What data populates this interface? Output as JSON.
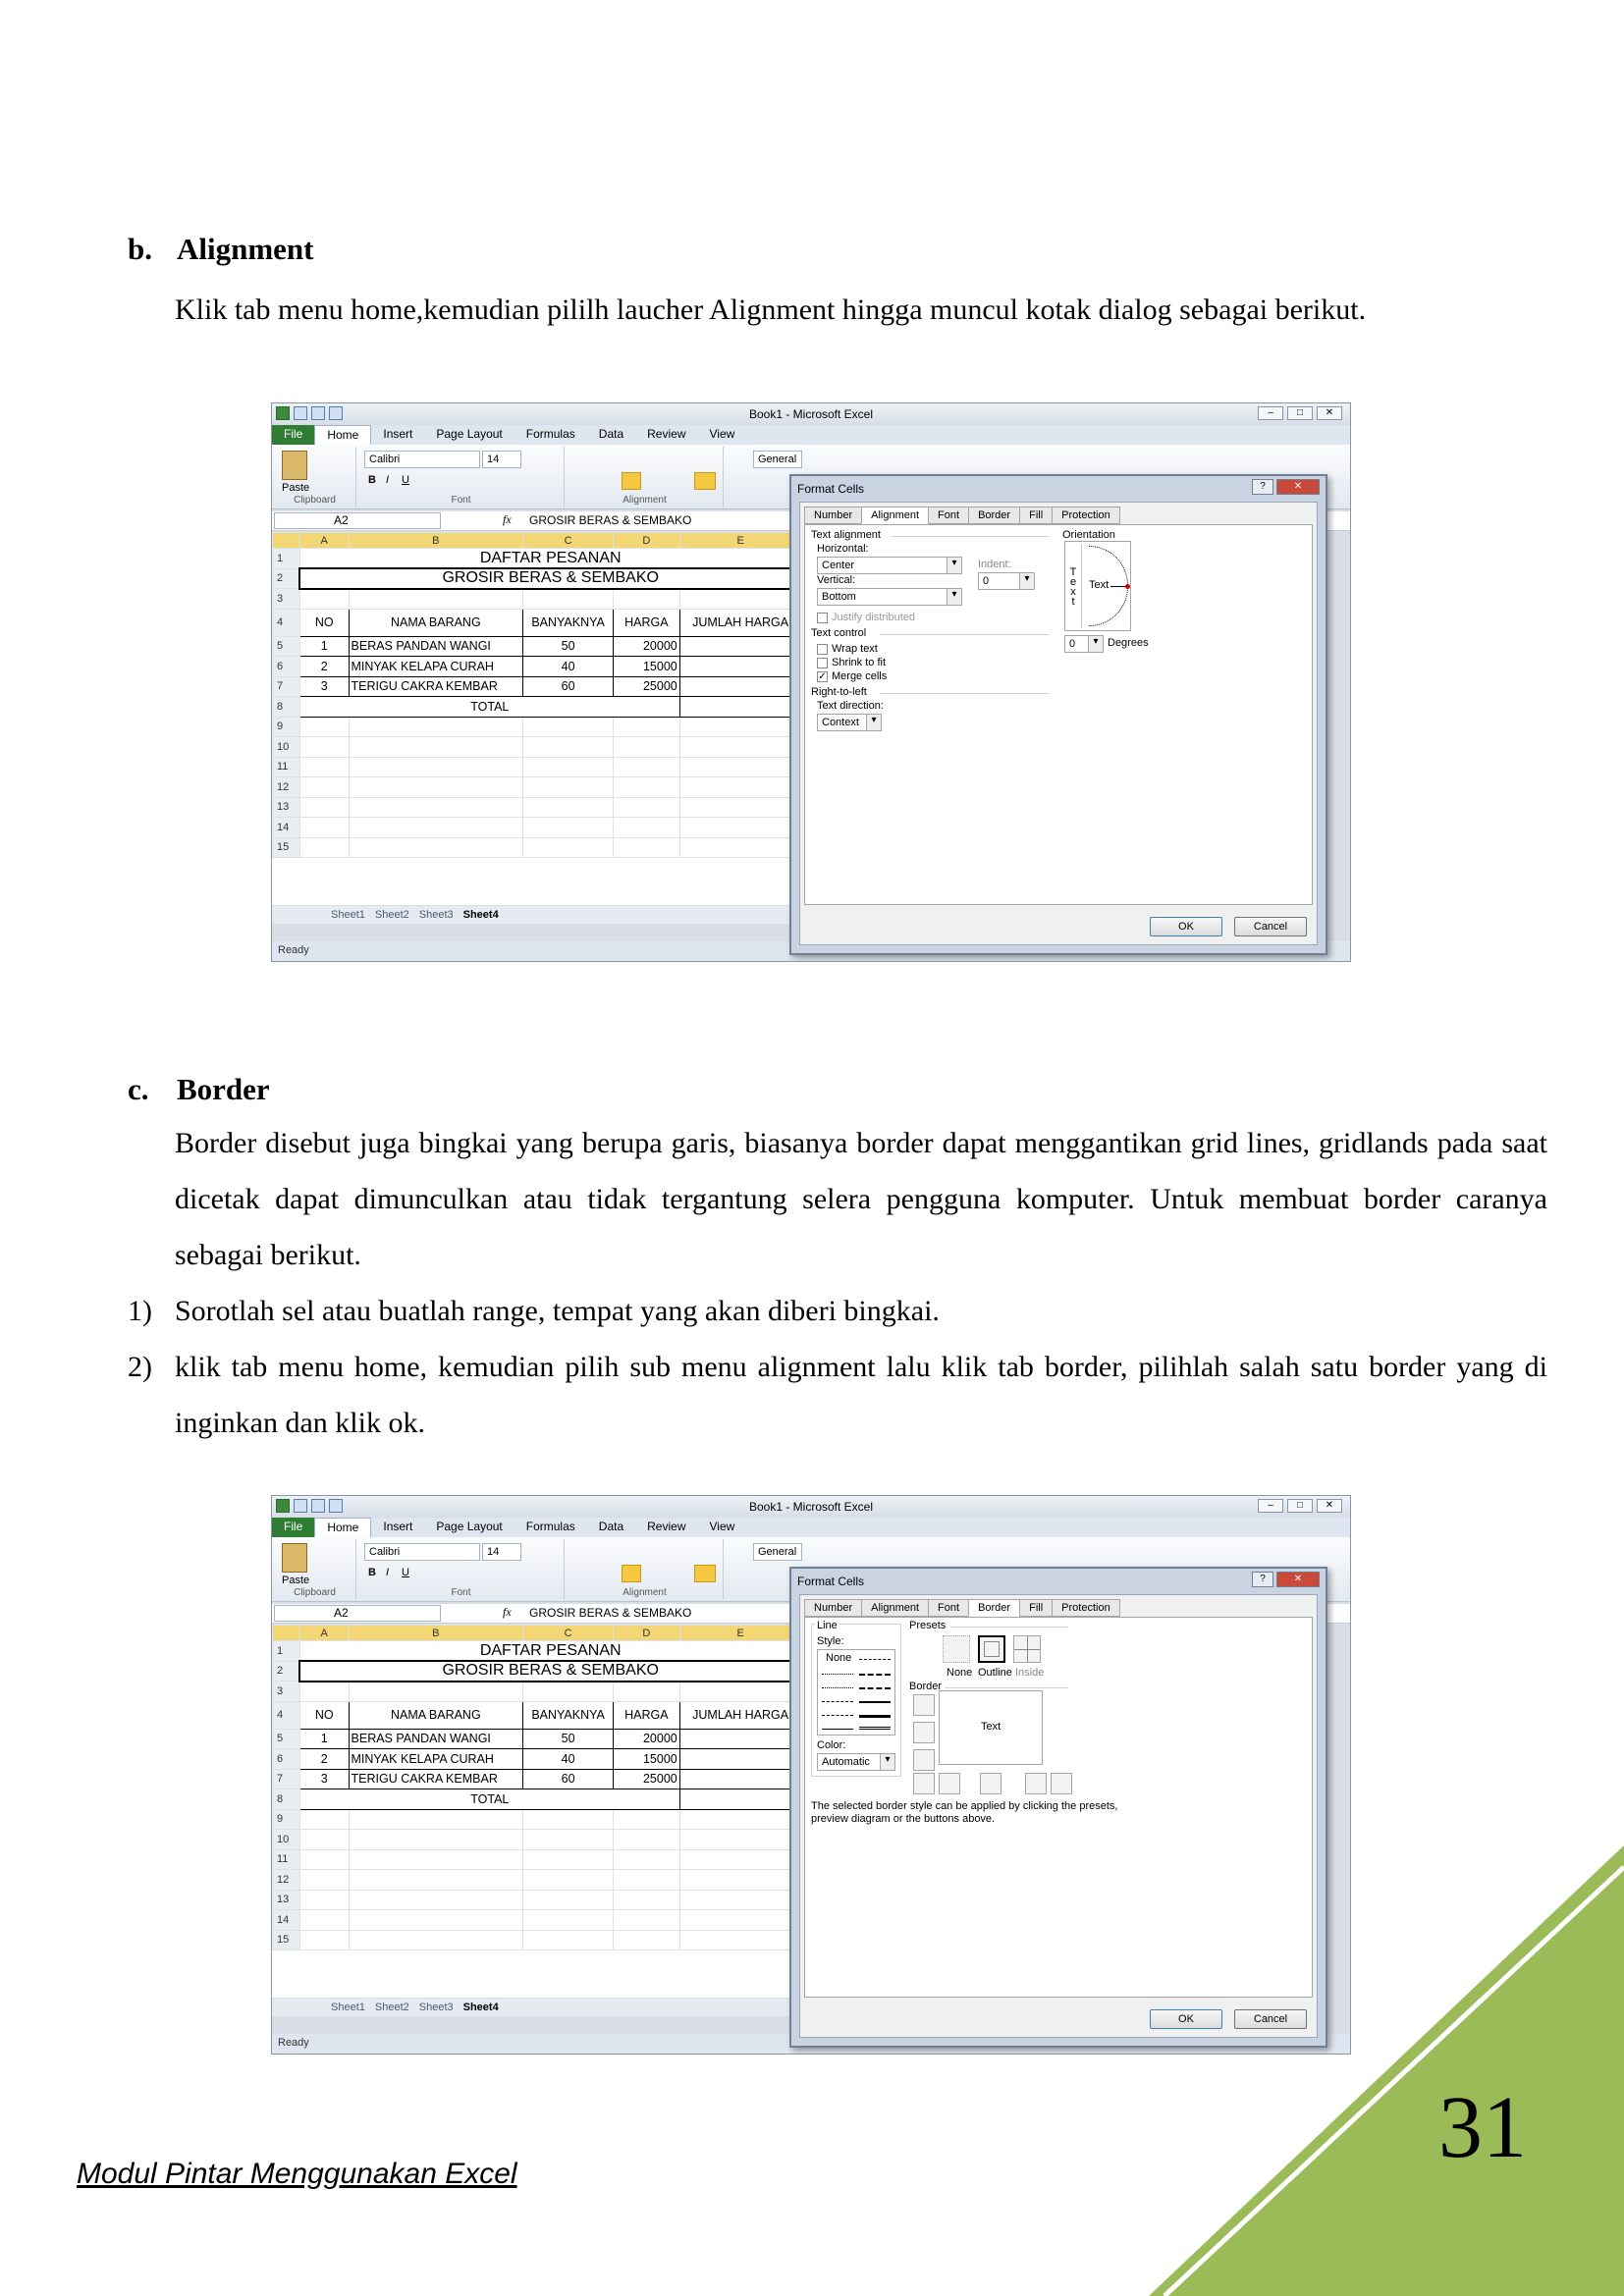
{
  "sections": {
    "b": {
      "letter": "b.",
      "title": "Alignment",
      "text": "Klik tab menu home,kemudian pililh laucher Alignment hingga muncul kotak dialog sebagai berikut."
    },
    "c": {
      "letter": "c.",
      "title": "Border",
      "text": "Border disebut juga bingkai yang berupa garis, biasanya border dapat menggantikan grid lines, gridlands pada saat dicetak dapat dimunculkan atau tidak tergantung selera pengguna komputer. Untuk membuat border caranya sebagai berikut."
    }
  },
  "steps": [
    {
      "n": "1)",
      "text": "Sorotlah  sel atau buatlah range, tempat yang akan diberi bingkai."
    },
    {
      "n": "2)",
      "text": "klik tab menu home, kemudian pilih sub menu alignment lalu klik tab border, pilihlah salah satu border yang di inginkan dan klik ok."
    }
  ],
  "excel": {
    "window_title": "Book1 - Microsoft Excel",
    "tabs": [
      "File",
      "Home",
      "Insert",
      "Page Layout",
      "Formulas",
      "Data",
      "Review",
      "View"
    ],
    "ribbon": {
      "paste": "Paste",
      "clipboard": "Clipboard",
      "font_name": "Calibri",
      "font_size": "14",
      "font": "Font",
      "alignment": "Alignment",
      "number_format": "General",
      "insert": "Insert",
      "bold": "B",
      "italic": "I",
      "underline": "U"
    },
    "name_box": "A2",
    "fx": "fx",
    "formula": "GROSIR BERAS & SEMBAKO",
    "columns": [
      "A",
      "B",
      "C",
      "D",
      "E"
    ],
    "title1": "DAFTAR PESANAN",
    "title2": "GROSIR BERAS & SEMBAKO",
    "headers": [
      "NO",
      "NAMA BARANG",
      "BANYAKNYA",
      "HARGA",
      "JUMLAH HARGA"
    ],
    "rows": [
      [
        "1",
        "BERAS PANDAN WANGI",
        "50",
        "20000"
      ],
      [
        "2",
        "MINYAK KELAPA CURAH",
        "40",
        "15000"
      ],
      [
        "3",
        "TERIGU CAKRA KEMBAR",
        "60",
        "25000"
      ]
    ],
    "total": "TOTAL",
    "row_numbers": [
      "1",
      "2",
      "3",
      "4",
      "5",
      "6",
      "7",
      "8",
      "9",
      "10",
      "11",
      "12",
      "13",
      "14",
      "15"
    ],
    "sheets": [
      "Sheet1",
      "Sheet2",
      "Sheet3",
      "Sheet4"
    ],
    "status": "Ready",
    "dialog_title": "Format Cells",
    "dialog_tabs": [
      "Number",
      "Alignment",
      "Font",
      "Border",
      "Fill",
      "Protection"
    ],
    "ok": "OK",
    "cancel": "Cancel"
  },
  "alignment_dialog": {
    "text_alignment": "Text alignment",
    "horizontal_label": "Horizontal:",
    "horizontal_value": "Center",
    "indent_label": "Indent:",
    "indent_value": "0",
    "vertical_label": "Vertical:",
    "vertical_value": "Bottom",
    "justify": "Justify distributed",
    "text_control": "Text control",
    "wrap": "Wrap text",
    "shrink": "Shrink to fit",
    "merge": "Merge cells",
    "rtl": "Right-to-left",
    "direction_label": "Text direction:",
    "direction_value": "Context",
    "orientation": "Orientation",
    "vertical_text": "T e x t",
    "text": "Text",
    "degrees_value": "0",
    "degrees": "Degrees"
  },
  "border_dialog": {
    "line": "Line",
    "style": "Style:",
    "none_style": "None",
    "color": "Color:",
    "color_value": "Automatic",
    "presets": "Presets",
    "preset_none": "None",
    "preset_outline": "Outline",
    "preset_inside": "Inside",
    "border": "Border",
    "text": "Text",
    "note": "The selected border style can be applied by clicking the presets, preview diagram or the buttons above."
  },
  "footer": "Modul Pintar Menggunakan Excel",
  "page_number": "31",
  "colors": {
    "triangle": "#9bbb59",
    "triangle_edge": "#ffffff"
  }
}
